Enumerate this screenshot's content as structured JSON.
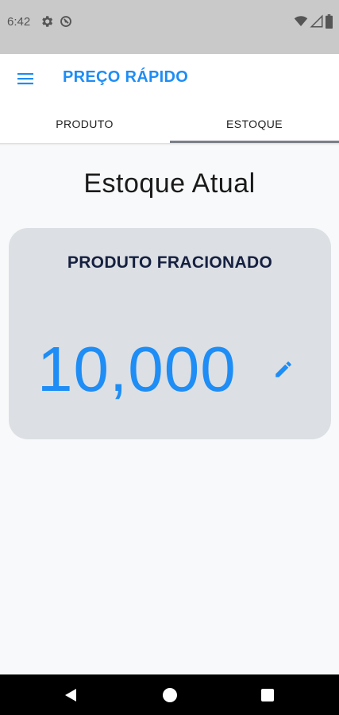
{
  "status_bar": {
    "time": "6:42",
    "icons": [
      "gear-icon",
      "sync-icon",
      "wifi-icon",
      "signal-icon",
      "battery-icon"
    ]
  },
  "app_bar": {
    "title": "PREÇO RÁPIDO",
    "menu_icon": "menu-icon",
    "accent_color": "#1e8df5"
  },
  "tabs": [
    {
      "label": "PRODUTO",
      "selected": false
    },
    {
      "label": "ESTOQUE",
      "selected": true
    }
  ],
  "main": {
    "title": "Estoque Atual",
    "card": {
      "label": "PRODUTO FRACIONADO",
      "value": "10,000",
      "edit_icon": "pencil-icon"
    }
  },
  "nav_bar": {
    "icons": [
      "back-icon",
      "home-icon",
      "recent-apps-icon"
    ]
  }
}
